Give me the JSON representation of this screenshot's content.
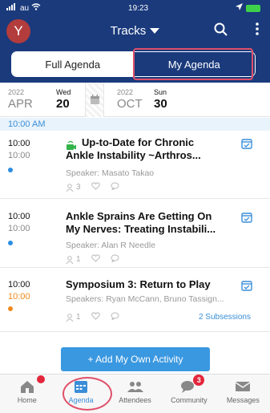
{
  "status": {
    "carrier": "au",
    "time": "19:23"
  },
  "header": {
    "avatar_initial": "Y",
    "title": "Tracks"
  },
  "segments": {
    "full": "Full Agenda",
    "my": "My Agenda"
  },
  "dates": {
    "start": {
      "year": "2022",
      "month": "APR",
      "weekday": "Wed",
      "day": "20"
    },
    "end": {
      "year": "2022",
      "month": "OCT",
      "weekday": "Sun",
      "day": "30"
    }
  },
  "time_header": "10:00 AM",
  "sessions": [
    {
      "start": "10:00",
      "end": "10:00",
      "title_line1": "Up-to-Date for Chronic",
      "title_line2": "Ankle Instability ~Arthros...",
      "speaker": "Speaker: Masato Takao",
      "attendees": "3",
      "dot_color": "#2a8ee0"
    },
    {
      "start": "10:00",
      "end": "10:00",
      "title_line1": "Ankle Sprains Are Getting On",
      "title_line2": "My Nerves: Treating Instabili...",
      "speaker": "Speaker: Alan R Needle",
      "attendees": "1",
      "dot_color": "#2a8ee0"
    },
    {
      "start": "10:00",
      "end": "10:00",
      "title_line1": "Symposium 3: Return to Play",
      "speaker": "Speakers: Ryan McCann, Bruno Tassign...",
      "attendees": "1",
      "subsessions": "2 Subsessions",
      "dot_color": "#f08a1e"
    }
  ],
  "add_activity": "+ Add My Own Activity",
  "tabs": [
    {
      "label": "Home",
      "icon": "home-icon"
    },
    {
      "label": "Agenda",
      "icon": "calendar-icon"
    },
    {
      "label": "Attendees",
      "icon": "people-icon"
    },
    {
      "label": "Community",
      "icon": "chat-icon",
      "badge": "3"
    },
    {
      "label": "Messages",
      "icon": "envelope-icon"
    }
  ],
  "colors": {
    "header": "#1a3a7c",
    "accent": "#3a8ed8",
    "highlight": "#e0506a",
    "badge": "#e3263b"
  }
}
